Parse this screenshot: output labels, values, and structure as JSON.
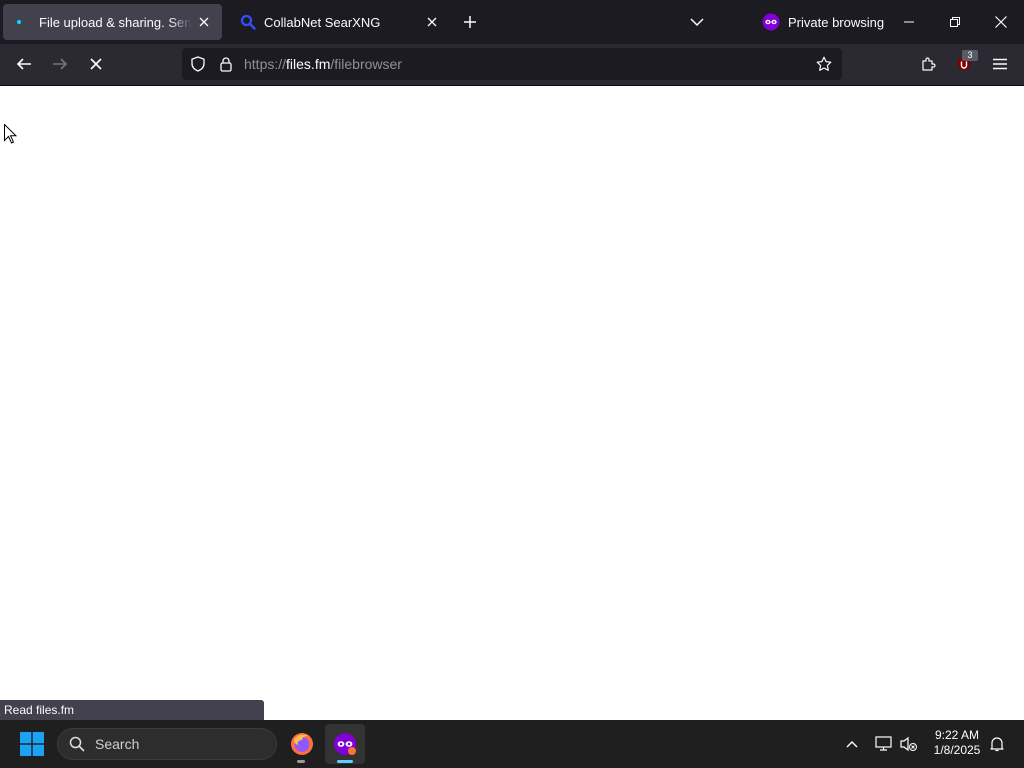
{
  "browser": {
    "tabs": [
      {
        "title": "File upload & sharing. Send large files",
        "active": true
      },
      {
        "title": "CollabNet SearXNG",
        "active": false
      }
    ],
    "private_label": "Private browsing",
    "url": {
      "scheme": "https://",
      "host": "files.fm",
      "path": "/filebrowser"
    },
    "extension_badge": "3",
    "status_text": "Read files.fm"
  },
  "icons": {
    "new_tab": "plus-icon",
    "tab_list": "chevron-down-icon",
    "private": "private-mask-icon",
    "back": "back-arrow-icon",
    "forward": "forward-arrow-icon",
    "stop": "stop-icon",
    "shield": "tracking-shield-icon",
    "lock": "lock-icon",
    "bookmark": "star-icon",
    "extensions": "puzzle-icon",
    "ublock": "ublock-icon",
    "menu": "hamburger-icon"
  },
  "taskbar": {
    "search_placeholder": "Search",
    "time": "9:22 AM",
    "date": "1/8/2025"
  },
  "colors": {
    "tab_strip": "#1c1b22",
    "active_tab": "#42414d",
    "nav_bar": "#2b2a33",
    "url_field": "#1c1b22",
    "taskbar": "#1f1f1f",
    "private_purple": "#8000d7",
    "accent_blue": "#0078d4"
  }
}
